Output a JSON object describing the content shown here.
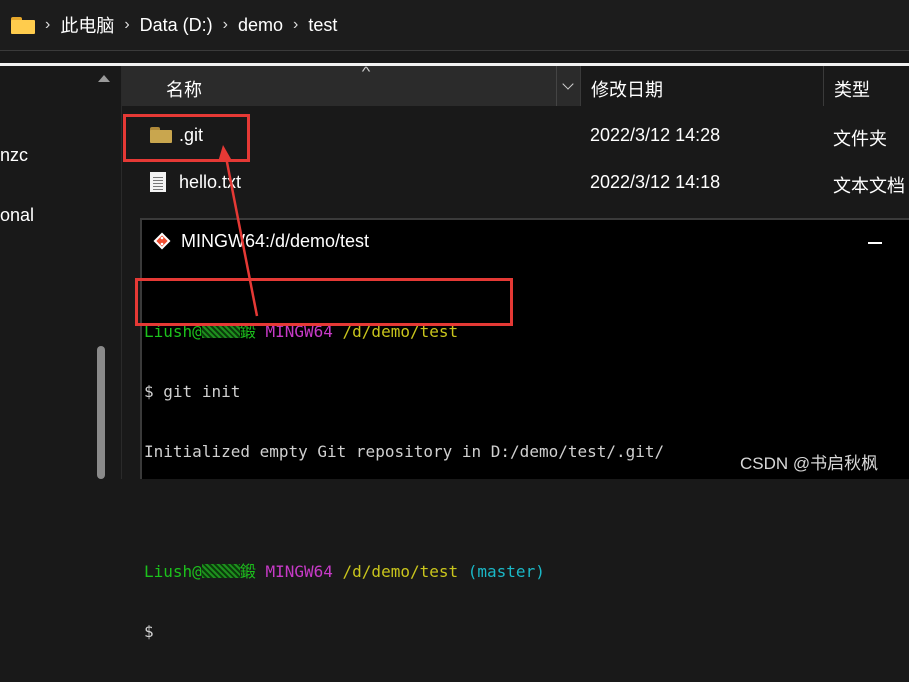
{
  "address_bar": {
    "icon": "folder-icon",
    "crumbs": [
      "此电脑",
      "Data (D:)",
      "demo",
      "test"
    ]
  },
  "nav": {
    "items": [
      "nzc",
      "onal"
    ]
  },
  "columns": {
    "name": "名称",
    "date": "修改日期",
    "type": "类型"
  },
  "files": [
    {
      "name": ".git",
      "date": "2022/3/12 14:28",
      "type": "文件夹",
      "icon": "folder-icon"
    },
    {
      "name": "hello.txt",
      "date": "2022/3/12 14:18",
      "type": "文本文档",
      "icon": "text-file-icon"
    }
  ],
  "terminal": {
    "title": "MINGW64:/d/demo/test",
    "lines": [
      {
        "user": "Liush@",
        "host_suffix": "鍛",
        "env": "MINGW64",
        "path": "/d/demo/test",
        "branch": ""
      },
      {
        "prompt": "$",
        "cmd": "git init"
      },
      {
        "output": "Initialized empty Git repository in D:/demo/test/.git/"
      },
      {
        "blank": ""
      },
      {
        "user": "Liush@",
        "host_suffix": "鍛",
        "env": "MINGW64",
        "path": "/d/demo/test",
        "branch": "(master)"
      },
      {
        "prompt": "$"
      }
    ]
  },
  "watermark": "CSDN @书启秋枫",
  "colors": {
    "annotation": "#e53935",
    "prompt_user": "#1cc11c",
    "prompt_env": "#c73ac7",
    "prompt_path": "#c9c51c",
    "prompt_branch": "#1ab8c7"
  }
}
